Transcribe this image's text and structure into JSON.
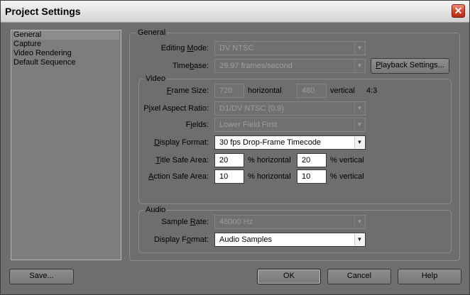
{
  "window": {
    "title": "Project Settings"
  },
  "sidebar": {
    "items": [
      {
        "label": "General",
        "selected": true
      },
      {
        "label": "Capture",
        "selected": false
      },
      {
        "label": "Video Rendering",
        "selected": false
      },
      {
        "label": "Default Sequence",
        "selected": false
      }
    ]
  },
  "general": {
    "group_title": "General",
    "editing_mode": {
      "label_pre": "Editing ",
      "label_u": "M",
      "label_post": "ode:",
      "value": "DV NTSC"
    },
    "timebase": {
      "label_pre": "Time",
      "label_u": "b",
      "label_post": "ase:",
      "value": "29.97 frames/second"
    },
    "playback_settings": {
      "label_u": "P",
      "label_post": "layback Settings..."
    }
  },
  "video": {
    "group_title": "Video",
    "frame_size": {
      "label_u": "F",
      "label_post": "rame Size:",
      "width": "720",
      "horizontal_label": "horizontal",
      "height": "480",
      "vertical_label": "vertical",
      "aspect": "4:3"
    },
    "pixel_aspect": {
      "label_pre": "P",
      "label_u": "i",
      "label_post": "xel Aspect Ratio:",
      "value": "D1/DV NTSC (0.9)"
    },
    "fields": {
      "label_pre": "F",
      "label_u": "i",
      "label_post": "elds:",
      "value": "Lower Field First"
    },
    "display_format": {
      "label_u": "D",
      "label_post": "isplay Format:",
      "value": "30 fps Drop-Frame Timecode"
    },
    "title_safe": {
      "label_u": "T",
      "label_post": "itle Safe Area:",
      "h_value": "20",
      "h_label": "% horizontal",
      "v_value": "20",
      "v_label": "% vertical"
    },
    "action_safe": {
      "label_u": "A",
      "label_post": "ction Safe Area:",
      "h_value": "10",
      "h_label": "% horizontal",
      "v_value": "10",
      "v_label": "% vertical"
    }
  },
  "audio": {
    "group_title": "Audio",
    "sample_rate": {
      "label_pre": "Sample ",
      "label_u": "R",
      "label_post": "ate:",
      "value": "48000 Hz"
    },
    "display_format": {
      "label_pre": "Display F",
      "label_u": "o",
      "label_post": "rmat:",
      "value": "Audio Samples"
    }
  },
  "buttons": {
    "save": "Save...",
    "ok": "OK",
    "cancel": "Cancel",
    "help": "Help"
  },
  "icons": {
    "close": "close-icon",
    "dropdown": "chevron-down-icon"
  }
}
